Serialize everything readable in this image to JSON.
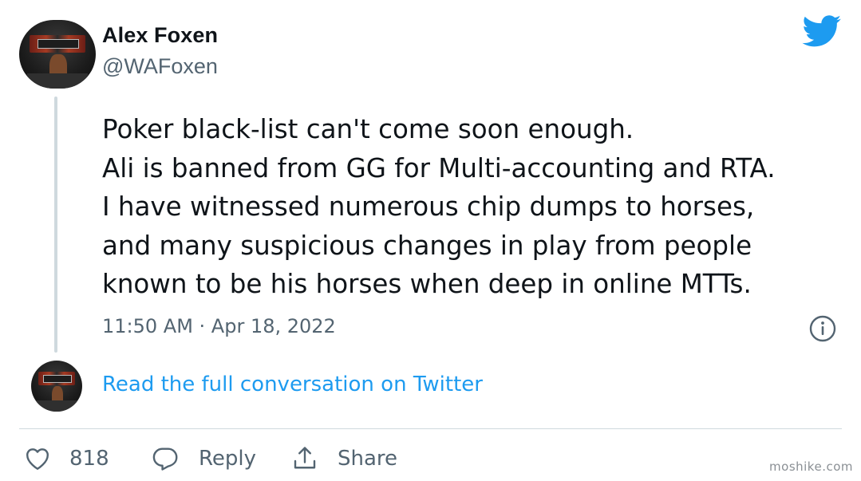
{
  "author": {
    "name": "Alex Foxen",
    "handle": "@WAFoxen"
  },
  "tweet": {
    "lines": [
      "Poker black-list can't come soon enough.",
      "Ali is banned from GG for Multi-accounting and RTA.",
      "I have witnessed numerous chip dumps to horses,",
      "and many suspicious changes in play from people",
      "known to be his horses when deep in online MTTs."
    ],
    "timestamp": "11:50 AM · Apr 18, 2022"
  },
  "conversation_link": "Read the full conversation on Twitter",
  "actions": {
    "like_count": "818",
    "reply_label": "Reply",
    "share_label": "Share"
  },
  "watermark": "moshike.com",
  "icons": {
    "brand": "twitter-bird-icon",
    "info": "info-icon",
    "like": "heart-icon",
    "reply": "speech-bubble-icon",
    "share": "share-upload-icon"
  },
  "colors": {
    "text": "#0f1419",
    "secondary": "#536471",
    "link": "#1d9bf0",
    "twitter_blue": "#1d9bf0",
    "divider": "#cfd9de"
  }
}
